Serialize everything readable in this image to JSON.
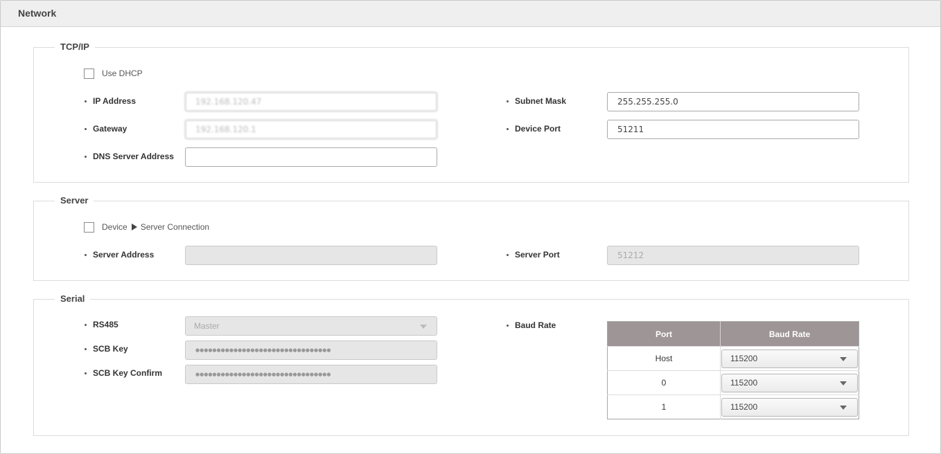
{
  "panel": {
    "title": "Network"
  },
  "tcpip": {
    "legend": "TCP/IP",
    "use_dhcp": {
      "label": "Use DHCP",
      "checked": false
    },
    "ip_address": {
      "label": "IP Address",
      "value": "192.168.120.47"
    },
    "gateway": {
      "label": "Gateway",
      "value": "192.168.120.1"
    },
    "dns": {
      "label": "DNS Server Address",
      "value": ""
    },
    "subnet_mask": {
      "label": "Subnet Mask",
      "value": "255.255.255.0"
    },
    "device_port": {
      "label": "Device Port",
      "value": "51211"
    }
  },
  "server": {
    "legend": "Server",
    "connection": {
      "label_a": "Device",
      "label_b": "Server Connection",
      "checked": false
    },
    "address": {
      "label": "Server Address",
      "value": ""
    },
    "port": {
      "label": "Server Port",
      "value": "51212"
    }
  },
  "serial": {
    "legend": "Serial",
    "rs485": {
      "label": "RS485",
      "value": "Master"
    },
    "scb_key": {
      "label": "SCB Key",
      "value": "●●●●●●●●●●●●●●●●●●●●●●●●●●●●●●●●"
    },
    "scb_key_confirm": {
      "label": "SCB Key Confirm",
      "value": "●●●●●●●●●●●●●●●●●●●●●●●●●●●●●●●●"
    },
    "baud_rate": {
      "label": "Baud Rate",
      "columns": [
        "Port",
        "Baud Rate"
      ],
      "rows": [
        {
          "port": "Host",
          "rate": "115200"
        },
        {
          "port": "0",
          "rate": "115200"
        },
        {
          "port": "1",
          "rate": "115200"
        }
      ]
    }
  }
}
